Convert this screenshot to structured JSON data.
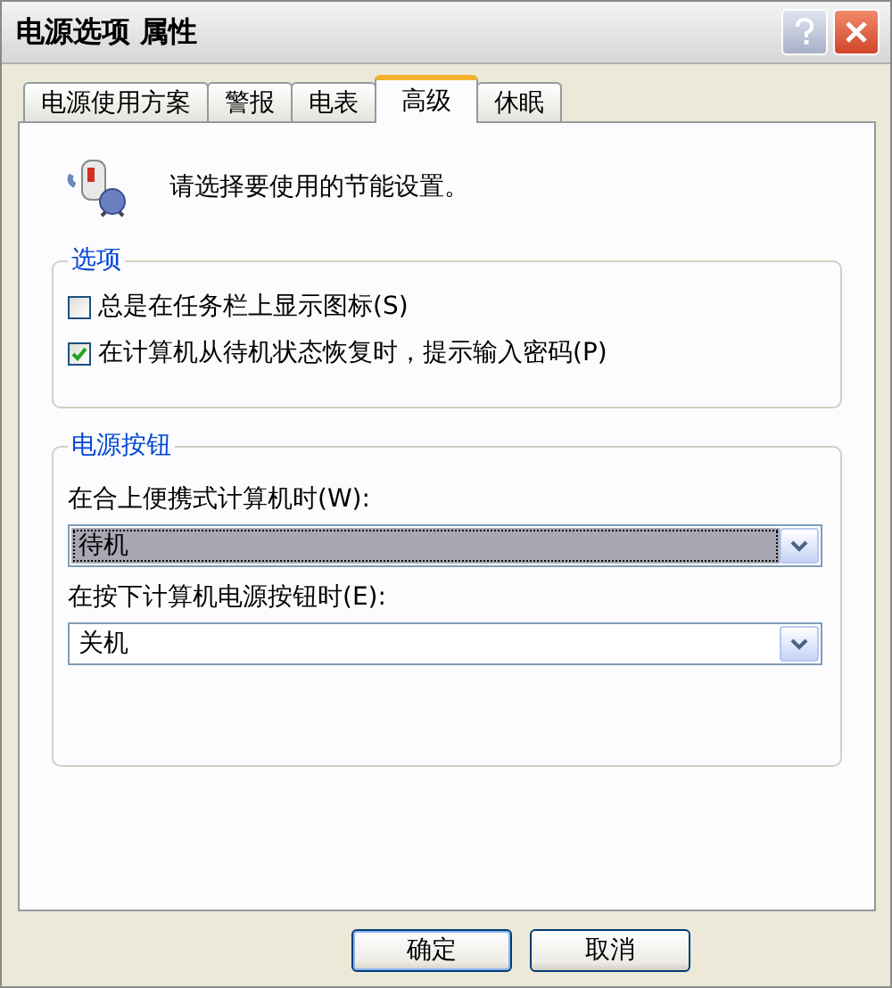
{
  "window": {
    "title": "电源选项 属性"
  },
  "tabs": [
    {
      "label": "电源使用方案",
      "selected": false
    },
    {
      "label": "警报",
      "selected": false
    },
    {
      "label": "电表",
      "selected": false
    },
    {
      "label": "高级",
      "selected": true
    },
    {
      "label": "休眠",
      "selected": false
    }
  ],
  "intro": "请选择要使用的节能设置。",
  "options": {
    "title": "选项",
    "checkboxes": [
      {
        "label": "总是在任务栏上显示图标(S)",
        "checked": false
      },
      {
        "label": "在计算机从待机状态恢复时，提示输入密码(P)",
        "checked": true
      }
    ]
  },
  "power_buttons": {
    "title": "电源按钮",
    "dropdowns": [
      {
        "label": "在合上便携式计算机时(W):",
        "value": "待机",
        "focused": true
      },
      {
        "label": "在按下计算机电源按钮时(E):",
        "value": "关机",
        "focused": false
      }
    ]
  },
  "buttons": [
    "确定",
    "取消"
  ]
}
